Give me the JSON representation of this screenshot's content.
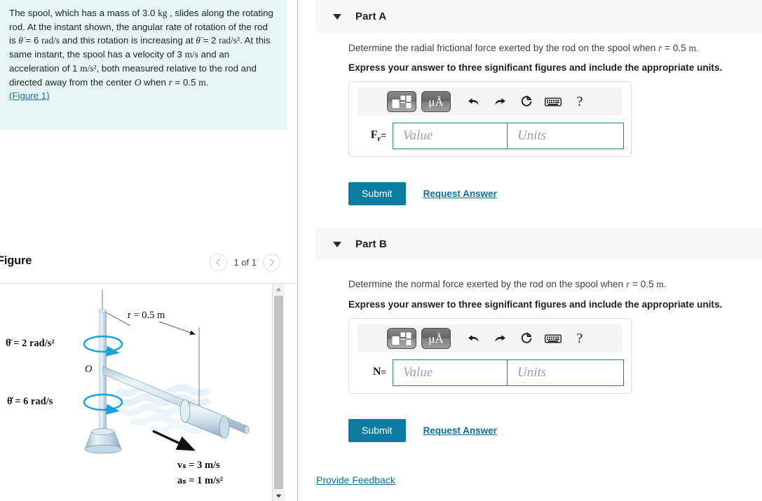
{
  "problem": {
    "text_runs": [
      {
        "t": "The spool, which has a mass of 3.0 ",
        "s": "n"
      },
      {
        "t": "kg",
        "s": "ser"
      },
      {
        "t": " , slides along the rotating rod. At the instant shown, the angular rate of rotation of the rod is ",
        "s": "n"
      },
      {
        "t": "θ̇",
        "s": "it"
      },
      {
        "t": " = 6 ",
        "s": "n"
      },
      {
        "t": "rad/s",
        "s": "ser"
      },
      {
        "t": " and this rotation is increasing at ",
        "s": "n"
      },
      {
        "t": "θ̈",
        "s": "it"
      },
      {
        "t": " = 2 ",
        "s": "n"
      },
      {
        "t": "rad/s²",
        "s": "ser"
      },
      {
        "t": ". At this same instant, the spool has a velocity of 3 ",
        "s": "n"
      },
      {
        "t": "m/s",
        "s": "ser"
      },
      {
        "t": " and an acceleration of 1 ",
        "s": "n"
      },
      {
        "t": "m/s²",
        "s": "ser"
      },
      {
        "t": ", both measured relative to the rod and directed away from the center ",
        "s": "n"
      },
      {
        "t": "O",
        "s": "it"
      },
      {
        "t": " when ",
        "s": "n"
      },
      {
        "t": "r",
        "s": "it"
      },
      {
        "t": " = 0.5 ",
        "s": "n"
      },
      {
        "t": "m",
        "s": "ser"
      },
      {
        "t": ".",
        "s": "n"
      }
    ],
    "figure_link": "(Figure 1)",
    "background_color": "#e6f4f2"
  },
  "figure_panel": {
    "title": "Figure",
    "counter": "1 of 1",
    "prev_icon": "chevron-left-icon",
    "next_icon": "chevron-right-icon",
    "scrollbar": {
      "up_icon": "scroll-up-arrow-icon",
      "down_icon": "scroll-down-arrow-icon"
    },
    "diagram": {
      "label_r": "r = 0.5 m",
      "label_alpha": "θ̈ = 2 rad/s²",
      "label_omega": "θ̇ = 6 rad/s",
      "label_origin": "O",
      "label_vs": "vₛ = 3 m/s",
      "label_as": "aₛ = 1 m/s²",
      "rod_color": "#c3d8e6",
      "arrow_color": "#1a9fe0"
    }
  },
  "parts": [
    {
      "id": "a",
      "header_label": "Part A",
      "caret_icon": "caret-down-icon",
      "prompt_runs": [
        {
          "t": "Determine the radial frictional force exerted by the rod on the spool when ",
          "s": "n"
        },
        {
          "t": "r",
          "s": "it"
        },
        {
          "t": " = 0.5 ",
          "s": "n"
        },
        {
          "t": "m",
          "s": "ser"
        },
        {
          "t": ".",
          "s": "n"
        }
      ],
      "instruction": "Express your answer to three significant figures and include the appropriate units.",
      "variable_label": "F",
      "variable_sub": "r",
      "equals": "=",
      "value_placeholder": "Value",
      "units_placeholder": "Units",
      "value_text": "",
      "units_text": "",
      "toolbar": [
        {
          "name": "template-layout-icon",
          "label": ""
        },
        {
          "name": "units-mu-angstrom-icon",
          "label": "μÅ"
        },
        {
          "name": "undo-icon",
          "label": ""
        },
        {
          "name": "redo-icon",
          "label": ""
        },
        {
          "name": "reset-icon",
          "label": ""
        },
        {
          "name": "keyboard-icon",
          "label": ""
        },
        {
          "name": "help-icon",
          "label": "?"
        }
      ],
      "submit_label": "Submit",
      "request_answer_label": "Request Answer"
    },
    {
      "id": "b",
      "header_label": "Part B",
      "caret_icon": "caret-down-icon",
      "prompt_runs": [
        {
          "t": "Determine the normal force exerted by the rod on the spool when ",
          "s": "n"
        },
        {
          "t": "r",
          "s": "it"
        },
        {
          "t": " = 0.5 ",
          "s": "n"
        },
        {
          "t": "m",
          "s": "ser"
        },
        {
          "t": ".",
          "s": "n"
        }
      ],
      "instruction": "Express your answer to three significant figures and include the appropriate units.",
      "variable_label": "N",
      "variable_sub": "",
      "equals": "=",
      "value_placeholder": "Value",
      "units_placeholder": "Units",
      "value_text": "",
      "units_text": "",
      "toolbar": [
        {
          "name": "template-layout-icon",
          "label": ""
        },
        {
          "name": "units-mu-angstrom-icon",
          "label": "μÅ"
        },
        {
          "name": "undo-icon",
          "label": ""
        },
        {
          "name": "redo-icon",
          "label": ""
        },
        {
          "name": "reset-icon",
          "label": ""
        },
        {
          "name": "keyboard-icon",
          "label": ""
        },
        {
          "name": "help-icon",
          "label": "?"
        }
      ],
      "submit_label": "Submit",
      "request_answer_label": "Request Answer"
    }
  ],
  "footer": {
    "provide_feedback_label": "Provide Feedback"
  },
  "colors": {
    "accent_teal": "#0a7ca0",
    "link_teal": "#0a6f96",
    "input_border": "#2b7a93",
    "panel_bg": "#f7f7f7",
    "problem_bg": "#e6f4f2",
    "divider": "#a8bccd"
  }
}
